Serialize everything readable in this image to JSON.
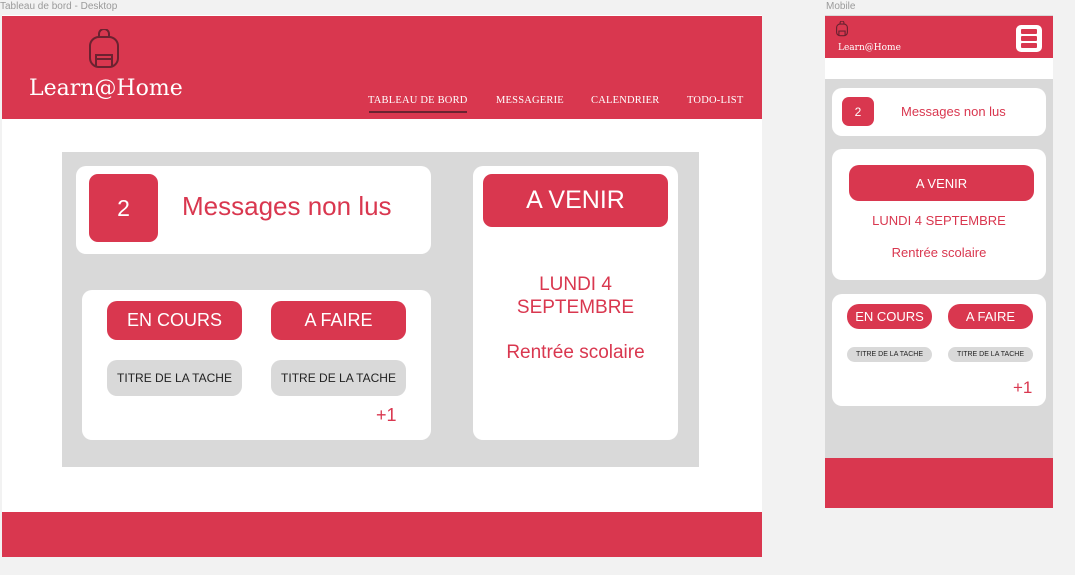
{
  "frames": {
    "desktop_label": "Tableau de bord - Desktop",
    "mobile_label": "Mobile"
  },
  "brand": {
    "name": "Learn@Home",
    "icon": "backpack-icon",
    "color": "#d9374f"
  },
  "nav": {
    "items": [
      {
        "label": "TABLEAU DE BORD",
        "active": true
      },
      {
        "label": "MESSAGERIE",
        "active": false
      },
      {
        "label": "CALENDRIER",
        "active": false
      },
      {
        "label": "TODO-LIST",
        "active": false
      }
    ]
  },
  "messages": {
    "count": "2",
    "label": "Messages non lus"
  },
  "upcoming": {
    "title": "A VENIR",
    "date": "LUNDI 4 SEPTEMBRE",
    "date_line1": "LUNDI 4",
    "date_line2": "SEPTEMBRE",
    "event": "Rentrée scolaire"
  },
  "tasks": {
    "in_progress_label": "EN COURS",
    "todo_label": "A FAIRE",
    "in_progress_task": "TITRE DE LA TACHE",
    "todo_task": "TITRE DE LA TACHE",
    "more": "+1"
  },
  "mobile": {
    "menu_icon": "menu-icon"
  }
}
